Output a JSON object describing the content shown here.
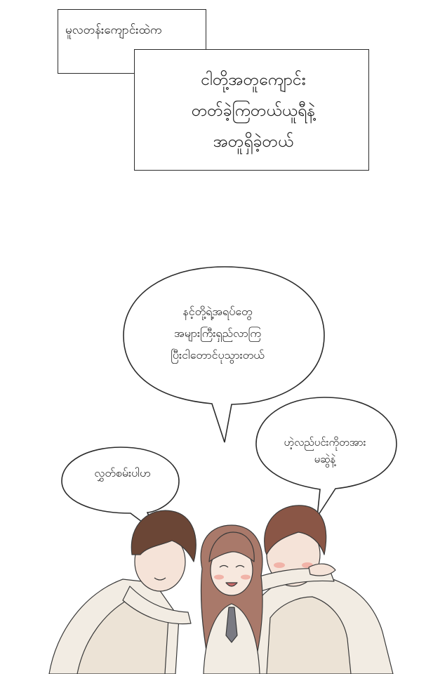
{
  "captions": {
    "small": "မူလတန်းကျောင်းထဲက",
    "big_lines": [
      "ငါတို့အတူကျောင်း",
      "တတ်ခဲ့ကြတယ်ယူရီနဲ့",
      "အတူရှိခဲ့တယ်"
    ]
  },
  "bubbles": {
    "center_lines": [
      "နင့်တို့ရဲ့အရပ်တွေ",
      "အများကြီးရှည်လာကြ",
      "ပြီးငါတောင်ပုသွားတယ်"
    ],
    "left_lines": [
      "လွှတ်စမ်းပါဟ"
    ],
    "right_lines": [
      "ဟဲ့လည်ပင်းကိုတအား",
      "မဆွဲနဲ့"
    ]
  },
  "colors": {
    "ink": "#2b2b2b",
    "hair_brown": "#6b4636",
    "hair_light": "#a9796a",
    "skin": "#f5e3d8",
    "sweater": "#f2ece3",
    "blush": "#f1b3a8"
  }
}
